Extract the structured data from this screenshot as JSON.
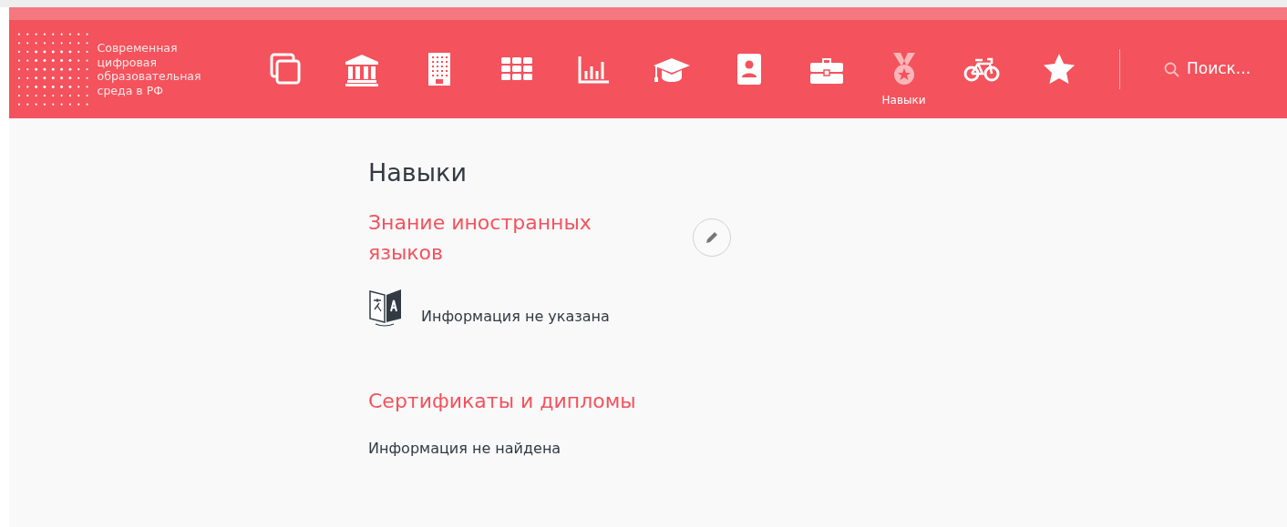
{
  "brand": {
    "text": "Современная цифровая образовательная среда в РФ"
  },
  "nav_items": [
    {
      "kind": "copy",
      "selected": false
    },
    {
      "kind": "institution",
      "selected": false
    },
    {
      "kind": "building",
      "selected": false
    },
    {
      "kind": "grid",
      "selected": false
    },
    {
      "kind": "chart",
      "selected": false
    },
    {
      "kind": "graduation",
      "selected": false
    },
    {
      "kind": "profile",
      "selected": false
    },
    {
      "kind": "briefcase",
      "selected": false
    },
    {
      "kind": "medal",
      "selected": true,
      "label": "Навыки"
    },
    {
      "kind": "bicycle",
      "selected": false
    },
    {
      "kind": "star",
      "selected": false
    }
  ],
  "search": {
    "placeholder": "Поиск..."
  },
  "page_title": "Навыки",
  "sections": [
    {
      "title": "Знание иностранных языков",
      "editable": true,
      "kind": "language",
      "message": "Информация не указана"
    },
    {
      "title": "Сертификаты и дипломы",
      "editable": false,
      "kind": "plain",
      "message": "Информация не найдена"
    }
  ]
}
